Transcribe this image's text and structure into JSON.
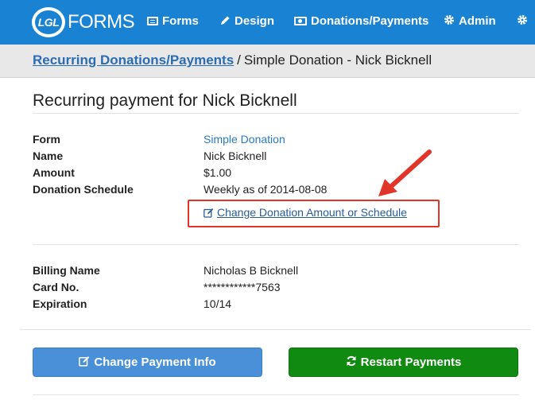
{
  "nav": {
    "logo_badge": "LGL",
    "logo_text": "FORMS",
    "items": [
      {
        "label": "Forms",
        "icon": "list-icon"
      },
      {
        "label": "Design",
        "icon": "pencil-icon"
      },
      {
        "label": "Donations/Payments",
        "icon": "money-icon"
      },
      {
        "label": "Admin",
        "icon": "gear-icon"
      },
      {
        "label": "",
        "icon": "gear-icon"
      }
    ]
  },
  "breadcrumb": {
    "parent": "Recurring Donations/Payments",
    "separator": "/",
    "current": "Simple Donation - Nick Bicknell"
  },
  "page_title": "Recurring payment for Nick Bicknell",
  "donation": {
    "form_label": "Form",
    "form_value": "Simple Donation",
    "name_label": "Name",
    "name_value": "Nick Bicknell",
    "amount_label": "Amount",
    "amount_value": "$1.00",
    "schedule_label": "Donation Schedule",
    "schedule_value": "Weekly as of 2014-08-08",
    "change_link": "Change Donation Amount or Schedule"
  },
  "billing": {
    "billing_name_label": "Billing Name",
    "billing_name_value": "Nicholas B Bicknell",
    "card_label": "Card No.",
    "card_value": "************7563",
    "expiration_label": "Expiration",
    "expiration_value": "10/14"
  },
  "buttons": {
    "change_payment": "Change Payment Info",
    "restart": "Restart Payments"
  },
  "colors": {
    "navbar": "#1a82d3",
    "annotation": "#e2352a",
    "primary_button": "#4a90d9",
    "success_button": "#108a10"
  }
}
